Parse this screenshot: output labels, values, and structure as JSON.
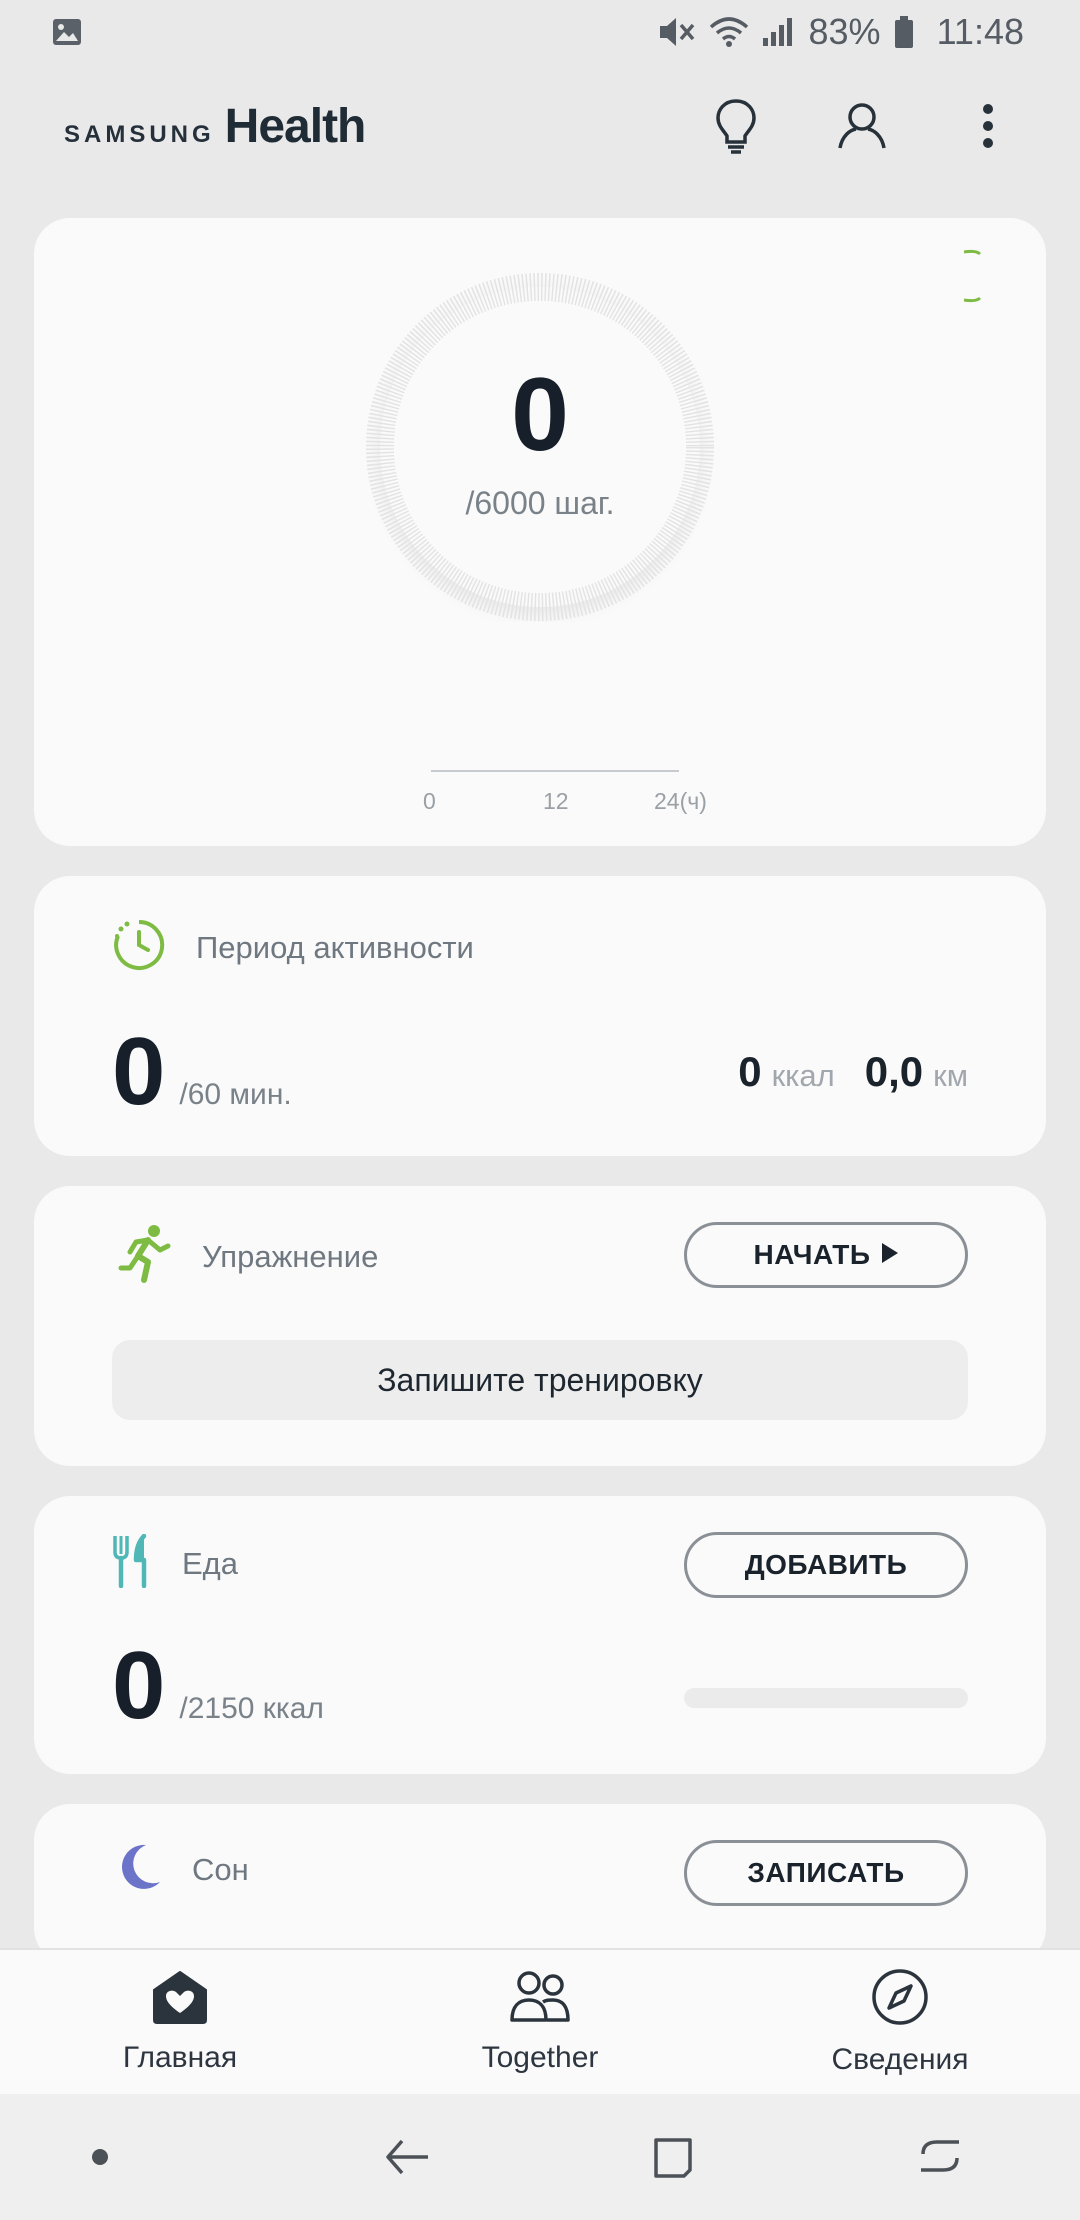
{
  "status_bar": {
    "battery": "83%",
    "time": "11:48",
    "icons": [
      "gallery-icon",
      "mute-icon",
      "wifi-icon",
      "signal-icon",
      "battery-icon"
    ]
  },
  "header": {
    "brand_samsung": "SAMSUNG",
    "brand_health": "Health",
    "actions": [
      "tips-bulb-icon",
      "profile-icon",
      "more-menu-icon"
    ]
  },
  "steps": {
    "count": "0",
    "goal": "/6000 шаг.",
    "axis_ticks": [
      "0",
      "12",
      "24(ч)"
    ]
  },
  "active_time": {
    "title": "Период активности",
    "value": "0",
    "goal": "/60 мин.",
    "calories_value": "0",
    "calories_unit": "ккал",
    "distance_value": "0,0",
    "distance_unit": "км"
  },
  "exercise": {
    "title": "Упражнение",
    "start_label": "НАЧАТЬ",
    "record_label": "Запишите тренировку"
  },
  "food": {
    "title": "Еда",
    "add_label": "ДОБАВИТЬ",
    "value": "0",
    "goal": "/2150 ккал",
    "progress_fraction": 0
  },
  "sleep": {
    "title": "Сон",
    "record_label": "ЗАПИСАТЬ"
  },
  "bottom_nav": {
    "items": [
      {
        "label": "Главная",
        "icon": "home-heart-icon"
      },
      {
        "label": "Together",
        "icon": "people-icon"
      },
      {
        "label": "Сведения",
        "icon": "compass-icon"
      }
    ]
  },
  "system_nav": {
    "buttons": [
      "dot-icon",
      "back-icon",
      "home-icon",
      "recents-icon"
    ]
  },
  "colors": {
    "accent_green": "#7dbb42",
    "moon_purple": "#6b74c9",
    "card_bg": "#fafafa",
    "page_bg": "#e9e9e9"
  }
}
